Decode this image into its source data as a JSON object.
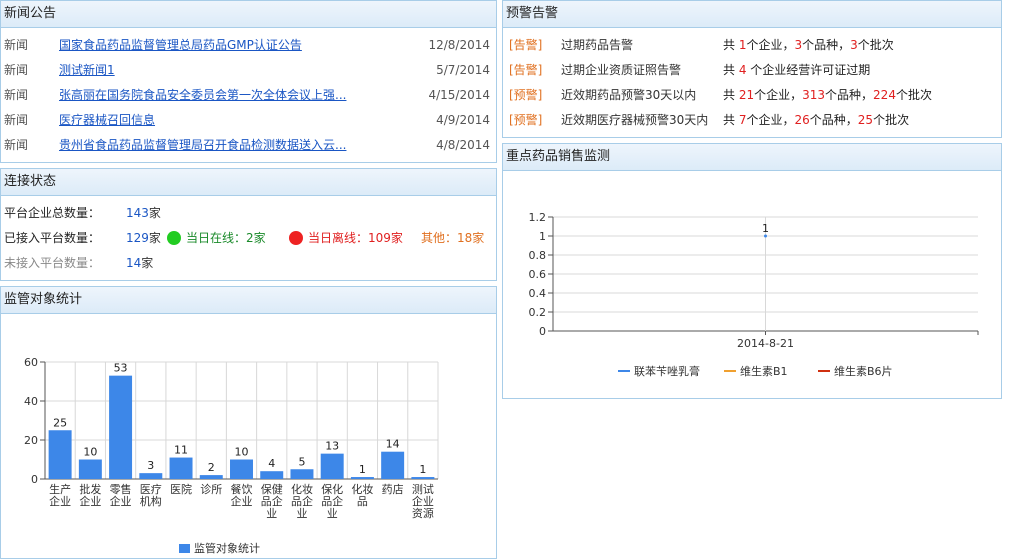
{
  "news": {
    "title": "新闻公告",
    "items": [
      {
        "category": "新闻",
        "title": "国家食品药品监督管理总局药品GMP认证公告",
        "date": "12/8/2014"
      },
      {
        "category": "新闻",
        "title": "测试新闻1",
        "date": "5/7/2014"
      },
      {
        "category": "新闻",
        "title": "张高丽在国务院食品安全委员会第一次全体会议上强...",
        "date": "4/15/2014"
      },
      {
        "category": "新闻",
        "title": "医疗器械召回信息",
        "date": "4/9/2014"
      },
      {
        "category": "新闻",
        "title": "贵州省食品药品监督管理局召开食品检测数据送入云...",
        "date": "4/8/2014"
      }
    ]
  },
  "connection": {
    "title": "连接状态",
    "total_label": "平台企业总数量：",
    "total_value": "143",
    "connected_label": "已接入平台数量：",
    "connected_value": "129",
    "unit": "家",
    "online_label": "当日在线：2家",
    "offline_label": "当日离线：109家",
    "other_label": "其他：18家",
    "not_connected_label": "未接入平台数量：",
    "not_connected_value": "14",
    "colors": {
      "online": "#22cc22",
      "offline": "#ee2222"
    }
  },
  "supervision": {
    "title": "监管对象统计"
  },
  "alerts": {
    "title": "预警告警",
    "items": [
      {
        "tag": "[告警]",
        "name": "过期药品告警",
        "parts": [
          [
            "共 ",
            false
          ],
          [
            "1",
            true
          ],
          [
            "个企业，",
            false
          ],
          [
            "3",
            true
          ],
          [
            "个品种，",
            false
          ],
          [
            "3",
            true
          ],
          [
            "个批次",
            false
          ]
        ]
      },
      {
        "tag": "[告警]",
        "name": "过期企业资质证照告警",
        "parts": [
          [
            "共 ",
            false
          ],
          [
            "4",
            true
          ],
          [
            " 个企业经营许可证过期",
            false
          ]
        ]
      },
      {
        "tag": "[预警]",
        "name": "近效期药品预警30天以内",
        "parts": [
          [
            "共 ",
            false
          ],
          [
            "21",
            true
          ],
          [
            "个企业，",
            false
          ],
          [
            "313",
            true
          ],
          [
            "个品种，",
            false
          ],
          [
            "224",
            true
          ],
          [
            "个批次",
            false
          ]
        ]
      },
      {
        "tag": "[预警]",
        "name": "近效期医疗器械预警30天内",
        "parts": [
          [
            "共 ",
            false
          ],
          [
            "7",
            true
          ],
          [
            "个企业，",
            false
          ],
          [
            "26",
            true
          ],
          [
            "个品种，",
            false
          ],
          [
            "25",
            true
          ],
          [
            "个批次",
            false
          ]
        ]
      }
    ]
  },
  "sales": {
    "title": "重点药品销售监测"
  },
  "chart_data": [
    {
      "type": "bar",
      "categories": [
        "生产企业",
        "批发企业",
        "零售企业",
        "医疗机构",
        "医院",
        "诊所",
        "餐饮企业",
        "保健品企业",
        "化妆品企业",
        "保化品企业",
        "化妆品",
        "药店",
        "测试企业资源"
      ],
      "category_lines": [
        [
          "生产",
          "企业"
        ],
        [
          "批发",
          "企业"
        ],
        [
          "零售",
          "企业"
        ],
        [
          "医疗",
          "机构"
        ],
        [
          "医院"
        ],
        [
          "诊所"
        ],
        [
          "餐饮",
          "企业"
        ],
        [
          "保健",
          "品企",
          "业"
        ],
        [
          "化妆",
          "品企",
          "业"
        ],
        [
          "保化",
          "品企",
          "业"
        ],
        [
          "化妆",
          "品"
        ],
        [
          "药店"
        ],
        [
          "测试",
          "企业",
          "资源"
        ]
      ],
      "series": [
        {
          "name": "监管对象统计",
          "values": [
            25,
            10,
            53,
            3,
            11,
            2,
            10,
            4,
            5,
            13,
            1,
            14,
            1
          ]
        }
      ],
      "ylim": [
        0,
        60
      ],
      "yticks": [
        0,
        20,
        40,
        60
      ],
      "color": "#3d87e8",
      "grid": true,
      "legend": "bottom"
    },
    {
      "type": "line",
      "x": [
        "2014-8-21"
      ],
      "series": [
        {
          "name": "联苯苄唑乳膏",
          "values": [
            1
          ],
          "color": "#3d87e8"
        },
        {
          "name": "维生素B1",
          "values": [],
          "color": "#f0a030"
        },
        {
          "name": "维生素B6片",
          "values": [],
          "color": "#d03010"
        }
      ],
      "ylim": [
        0,
        1.2
      ],
      "yticks": [
        "0",
        "0.2",
        "0.4",
        "0.6",
        "0.8",
        "1",
        "1.2"
      ],
      "data_labels": [
        "1"
      ],
      "grid": true,
      "legend": "bottom"
    }
  ]
}
